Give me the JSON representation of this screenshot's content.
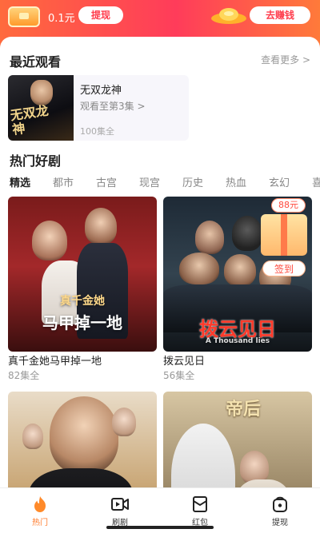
{
  "header": {
    "balance": "0.1元",
    "withdraw_label": "提现",
    "earn_label": "去赚钱",
    "icons": [
      "wallet-icon",
      "gold-ingot-icon"
    ]
  },
  "recent": {
    "title": "最近观看",
    "see_more": "查看更多 >",
    "item": {
      "name": "无双龙神",
      "progress": "观看至第3集 >",
      "count": "100集全",
      "poster_text": "无双龙神"
    }
  },
  "hot": {
    "title": "热门好剧",
    "tabs": [
      "精选",
      "都市",
      "古宫",
      "现宫",
      "历史",
      "热血",
      "玄幻",
      "喜"
    ]
  },
  "dramas": [
    {
      "title": "真千金她马甲掉一地",
      "count": "82集全",
      "poster_text_1": "真千金她",
      "poster_text_2": "马甲掉一地"
    },
    {
      "title": "拨云见日",
      "count": "56集全",
      "poster_text_1": "拨云见日",
      "poster_text_2": "A Thousand lies"
    },
    {
      "title": "",
      "count": ""
    },
    {
      "title": "",
      "count": "",
      "poster_text_1": "帝后"
    }
  ],
  "promo": {
    "badge": "88元",
    "checkin": "签到"
  },
  "nav": [
    {
      "label": "热门",
      "icon": "flame-icon",
      "active": true
    },
    {
      "label": "刷剧",
      "icon": "video-icon",
      "active": false
    },
    {
      "label": "红包",
      "icon": "red-packet-icon",
      "active": false
    },
    {
      "label": "提现",
      "icon": "withdraw-bag-icon",
      "active": false
    }
  ],
  "colors": {
    "accent": "#ff7a2a",
    "header_gradient": [
      "#ff6a3d",
      "#ff3c5a"
    ],
    "button_text": "#ff3c4c"
  }
}
